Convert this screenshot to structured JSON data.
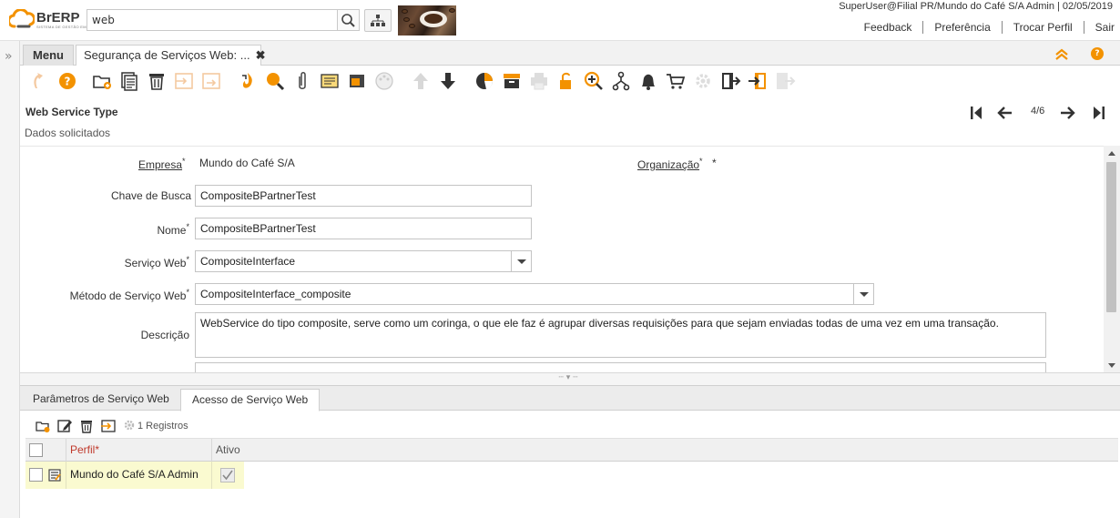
{
  "app": {
    "logo_text": "BrERP",
    "logo_sub": "SISTEMA DE GESTÃO EMPRESARIAL"
  },
  "search": {
    "value": "web"
  },
  "header": {
    "user_info": "SuperUser@Filial PR/Mundo do Café S/A Admin | 02/05/2019",
    "links": [
      "Feedback",
      "Preferência",
      "Trocar Perfil",
      "Sair"
    ]
  },
  "tabs": {
    "menu": "Menu",
    "window": "Segurança de Serviços Web: ...",
    "close": "✖"
  },
  "toolbar": {
    "icons": [
      "undo-icon",
      "help-icon",
      "new-record-icon",
      "copy-record-icon",
      "delete-icon",
      "save-icon",
      "save-create-icon",
      "refresh-icon",
      "find-icon",
      "attachment-icon",
      "chat-icon",
      "grid-toggle-icon",
      "history-icon",
      "parent-record-icon",
      "detail-record-icon",
      "report-icon",
      "archive-icon",
      "print-icon",
      "lock-icon",
      "zoom-across-icon",
      "workflow-icon",
      "notification-icon",
      "shopping-cart-icon",
      "process-icon",
      "export-icon",
      "import-icon",
      "file-import-icon"
    ]
  },
  "window": {
    "title": "Web Service Type",
    "record_position": "4/6"
  },
  "form": {
    "section": "Dados solicitados",
    "empresa_label": "Empresa",
    "empresa_value": "Mundo do Café S/A",
    "organizacao_label": "Organização",
    "organizacao_value": "*",
    "chave_label": "Chave de Busca",
    "chave_value": "CompositeBPartnerTest",
    "nome_label": "Nome",
    "nome_value": "CompositeBPartnerTest",
    "servico_label": "Serviço Web",
    "servico_value": "CompositeInterface",
    "metodo_label": "Método de Serviço Web",
    "metodo_value": "CompositeInterface_composite",
    "descricao_label": "Descrição",
    "descricao_value": "WebService do tipo composite, serve como um coringa, o que ele faz é agrupar diversas requisições para que sejam enviadas todas de uma vez em uma transação."
  },
  "detail": {
    "tabs": [
      "Parâmetros de Serviço Web",
      "Acesso de Serviço Web"
    ],
    "record_count": "1 Registros",
    "columns": [
      "Perfil*",
      "Ativo"
    ],
    "rows": [
      {
        "perfil": "Mundo do Café S/A Admin",
        "ativo": true
      }
    ]
  },
  "colors": {
    "accent_orange": "#f39200",
    "required_red": "#c0392b",
    "row_highlight": "#fafad0"
  }
}
